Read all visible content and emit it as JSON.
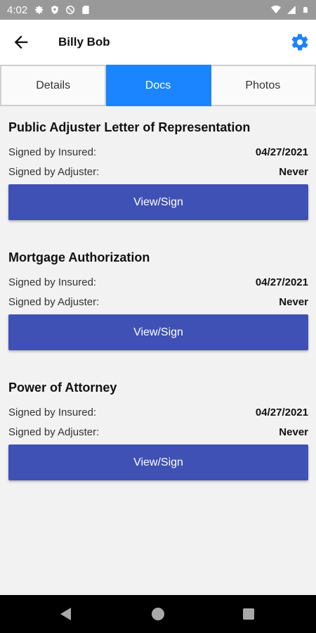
{
  "status": {
    "time": "4:02"
  },
  "appbar": {
    "title": "Billy Bob"
  },
  "tabs": [
    {
      "label": "Details",
      "active": false
    },
    {
      "label": "Docs",
      "active": true
    },
    {
      "label": "Photos",
      "active": false
    }
  ],
  "docs": [
    {
      "title": "Public Adjuster Letter of Representation",
      "insured_label": "Signed by Insured:",
      "insured_value": "04/27/2021",
      "adjuster_label": "Signed by Adjuster:",
      "adjuster_value": "Never",
      "button": "View/Sign"
    },
    {
      "title": "Mortgage Authorization",
      "insured_label": "Signed by Insured:",
      "insured_value": "04/27/2021",
      "adjuster_label": "Signed by Adjuster:",
      "adjuster_value": "Never",
      "button": "View/Sign"
    },
    {
      "title": "Power of Attorney",
      "insured_label": "Signed by Insured:",
      "insured_value": "04/27/2021",
      "adjuster_label": "Signed by Adjuster:",
      "adjuster_value": "Never",
      "button": "View/Sign"
    }
  ],
  "colors": {
    "accent": "#1a85ff",
    "button": "#3f51b5",
    "status_bar": "#999999"
  },
  "icons": {
    "status_left": [
      "gear-icon",
      "shield-icon",
      "no-sync-icon",
      "sd-card-icon"
    ],
    "status_right": [
      "wifi-icon",
      "signal-icon",
      "battery-icon"
    ],
    "appbar": [
      "back-arrow-icon",
      "settings-gear-icon"
    ]
  }
}
